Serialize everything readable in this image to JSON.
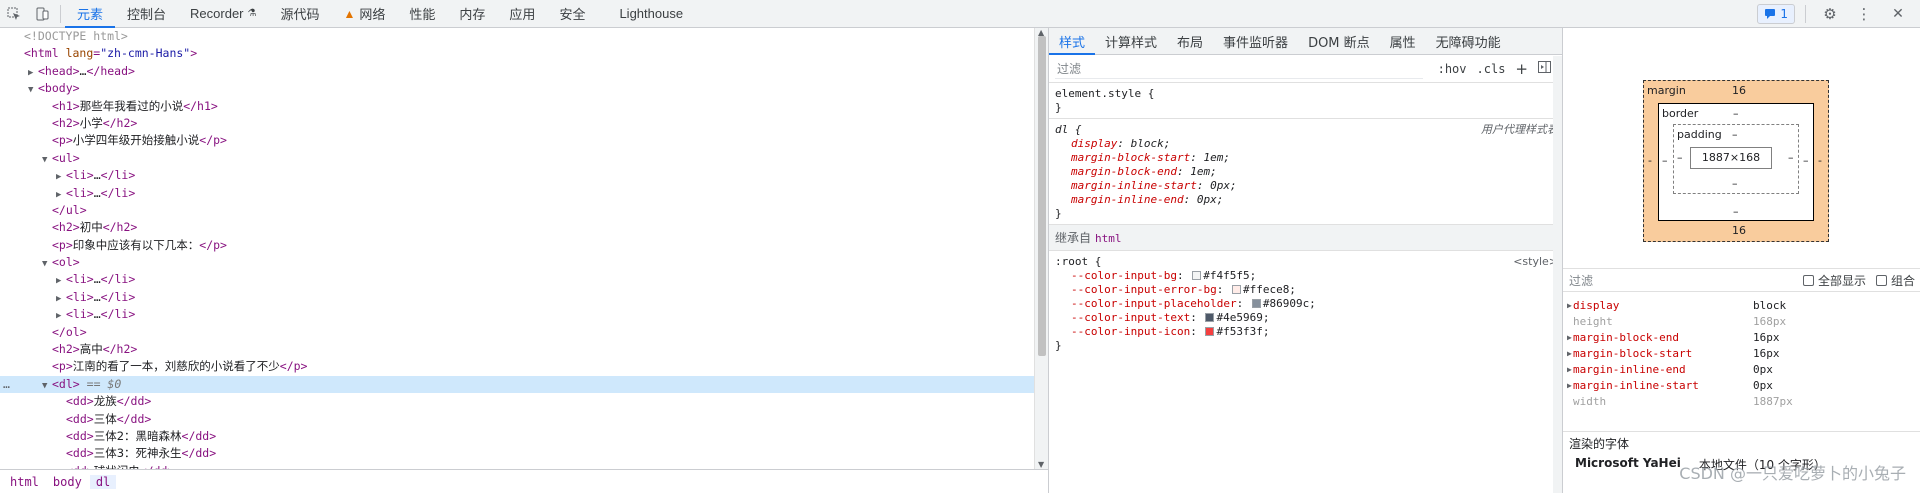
{
  "toolbar": {
    "tabs": [
      "元素",
      "控制台",
      "Recorder",
      "源代码",
      "网络",
      "性能",
      "内存",
      "应用",
      "安全",
      "Lighthouse"
    ],
    "issues_count": "1"
  },
  "dom": {
    "lines": [
      {
        "i": 0,
        "tri": "",
        "html": "<span class='comment'>&lt;!DOCTYPE html&gt;</span>"
      },
      {
        "i": 0,
        "tri": "",
        "html": "<span class='tag'>&lt;html</span> <span class='attr-n'>lang</span><span class='tag'>=</span><span class='attr-v'>\"zh-cmn-Hans\"</span><span class='tag'>&gt;</span>"
      },
      {
        "i": 1,
        "tri": "▶",
        "html": "<span class='tag'>&lt;head&gt;</span>…<span class='tag'>&lt;/head&gt;</span>"
      },
      {
        "i": 1,
        "tri": "▼",
        "html": "<span class='tag'>&lt;body&gt;</span>"
      },
      {
        "i": 2,
        "tri": "",
        "html": "<span class='tag'>&lt;h1&gt;</span><span class='txt'>那些年我看过的小说</span><span class='tag'>&lt;/h1&gt;</span>"
      },
      {
        "i": 2,
        "tri": "",
        "html": "<span class='tag'>&lt;h2&gt;</span><span class='txt'>小学</span><span class='tag'>&lt;/h2&gt;</span>"
      },
      {
        "i": 2,
        "tri": "",
        "html": "<span class='tag'>&lt;p&gt;</span><span class='txt'>小学四年级开始接触小说</span><span class='tag'>&lt;/p&gt;</span>"
      },
      {
        "i": 2,
        "tri": "▼",
        "html": "<span class='tag'>&lt;ul&gt;</span>"
      },
      {
        "i": 3,
        "tri": "▶",
        "html": "<span class='tag'>&lt;li&gt;</span>…<span class='tag'>&lt;/li&gt;</span>"
      },
      {
        "i": 3,
        "tri": "▶",
        "html": "<span class='tag'>&lt;li&gt;</span>…<span class='tag'>&lt;/li&gt;</span>"
      },
      {
        "i": 2,
        "tri": "",
        "html": "<span class='tag'>&lt;/ul&gt;</span>"
      },
      {
        "i": 2,
        "tri": "",
        "html": "<span class='tag'>&lt;h2&gt;</span><span class='txt'>初中</span><span class='tag'>&lt;/h2&gt;</span>"
      },
      {
        "i": 2,
        "tri": "",
        "html": "<span class='tag'>&lt;p&gt;</span><span class='txt'>印象中应该有以下几本：</span><span class='tag'>&lt;/p&gt;</span>"
      },
      {
        "i": 2,
        "tri": "▼",
        "html": "<span class='tag'>&lt;ol&gt;</span>"
      },
      {
        "i": 3,
        "tri": "▶",
        "html": "<span class='tag'>&lt;li&gt;</span>…<span class='tag'>&lt;/li&gt;</span>"
      },
      {
        "i": 3,
        "tri": "▶",
        "html": "<span class='tag'>&lt;li&gt;</span>…<span class='tag'>&lt;/li&gt;</span>"
      },
      {
        "i": 3,
        "tri": "▶",
        "html": "<span class='tag'>&lt;li&gt;</span>…<span class='tag'>&lt;/li&gt;</span>"
      },
      {
        "i": 2,
        "tri": "",
        "html": "<span class='tag'>&lt;/ol&gt;</span>"
      },
      {
        "i": 2,
        "tri": "",
        "html": "<span class='tag'>&lt;h2&gt;</span><span class='txt'>高中</span><span class='tag'>&lt;/h2&gt;</span>"
      },
      {
        "i": 2,
        "tri": "",
        "html": "<span class='tag'>&lt;p&gt;</span><span class='txt'>江南的看了一本，刘慈欣的小说看了不少</span><span class='tag'>&lt;/p&gt;</span>"
      },
      {
        "i": 2,
        "tri": "▼",
        "html": "<span class='tag'>&lt;dl&gt;</span> <span class='dollar'>== $0</span>",
        "selected": true
      },
      {
        "i": 3,
        "tri": "",
        "html": "<span class='tag'>&lt;dd&gt;</span><span class='txt'>龙族</span><span class='tag'>&lt;/dd&gt;</span>"
      },
      {
        "i": 3,
        "tri": "",
        "html": "<span class='tag'>&lt;dd&gt;</span><span class='txt'>三体</span><span class='tag'>&lt;/dd&gt;</span>"
      },
      {
        "i": 3,
        "tri": "",
        "html": "<span class='tag'>&lt;dd&gt;</span><span class='txt'>三体2：黑暗森林</span><span class='tag'>&lt;/dd&gt;</span>"
      },
      {
        "i": 3,
        "tri": "",
        "html": "<span class='tag'>&lt;dd&gt;</span><span class='txt'>三体3：死神永生</span><span class='tag'>&lt;/dd&gt;</span>"
      },
      {
        "i": 3,
        "tri": "",
        "html": "<span class='tag'>&lt;dd&gt;</span><span class='txt'>球状闪电</span><span class='tag'>&lt;/dd&gt;</span>"
      }
    ],
    "selected_marker": "…"
  },
  "breadcrumbs": [
    "html",
    "body",
    "dl"
  ],
  "styles": {
    "subtabs": [
      "样式",
      "计算样式",
      "布局",
      "事件监听器",
      "DOM 断点",
      "属性",
      "无障碍功能"
    ],
    "filter_placeholder": "过滤",
    "hov": ":hov",
    "cls": ".cls",
    "plus": "+",
    "element_style": "element.style {",
    "close_brace": "}",
    "dl_selector": "dl {",
    "ua_origin": "用户代理样式表",
    "dl_props": [
      {
        "n": "display",
        "v": "block;"
      },
      {
        "n": "margin-block-start",
        "v": "1em;"
      },
      {
        "n": "margin-block-end",
        "v": "1em;"
      },
      {
        "n": "margin-inline-start",
        "v": "0px;"
      },
      {
        "n": "margin-inline-end",
        "v": "0px;"
      }
    ],
    "inherit_label": "继承自",
    "inherit_tag": "html",
    "root_selector": ":root {",
    "root_origin": "<style>",
    "root_props": [
      {
        "n": "--color-input-bg",
        "v": "#f4f5f5;",
        "c": "#f4f5f5"
      },
      {
        "n": "--color-input-error-bg",
        "v": "#ffece8;",
        "c": "#ffece8"
      },
      {
        "n": "--color-input-placeholder",
        "v": "#86909c;",
        "c": "#86909c"
      },
      {
        "n": "--color-input-text",
        "v": "#4e5969;",
        "c": "#4e5969"
      },
      {
        "n": "--color-input-icon",
        "v": "#f53f3f;",
        "c": "#f53f3f"
      }
    ]
  },
  "computed": {
    "box": {
      "margin_label": "margin",
      "margin_top": "16",
      "margin_bottom": "16",
      "margin_left": "-",
      "margin_right": "-",
      "border_label": "border",
      "border_val": "–",
      "padding_label": "padding",
      "padding_val": "–",
      "content": "1887×168"
    },
    "filter_placeholder": "过滤",
    "show_all": "全部显示",
    "group": "组合",
    "props": [
      {
        "n": "display",
        "v": "block",
        "dim": false,
        "tri": true
      },
      {
        "n": "height",
        "v": "168px",
        "dim": true,
        "tri": false
      },
      {
        "n": "margin-block-end",
        "v": "16px",
        "dim": false,
        "tri": true
      },
      {
        "n": "margin-block-start",
        "v": "16px",
        "dim": false,
        "tri": true
      },
      {
        "n": "margin-inline-end",
        "v": "0px",
        "dim": false,
        "tri": true
      },
      {
        "n": "margin-inline-start",
        "v": "0px",
        "dim": false,
        "tri": true
      },
      {
        "n": "width",
        "v": "1887px",
        "dim": true,
        "tri": false
      }
    ],
    "fonts_header": "渲染的字体",
    "font_name": "Microsoft YaHei",
    "font_source": "本地文件（10 个字形）"
  },
  "watermark": "CSDN @一只爱吃萝卜的小兔子"
}
